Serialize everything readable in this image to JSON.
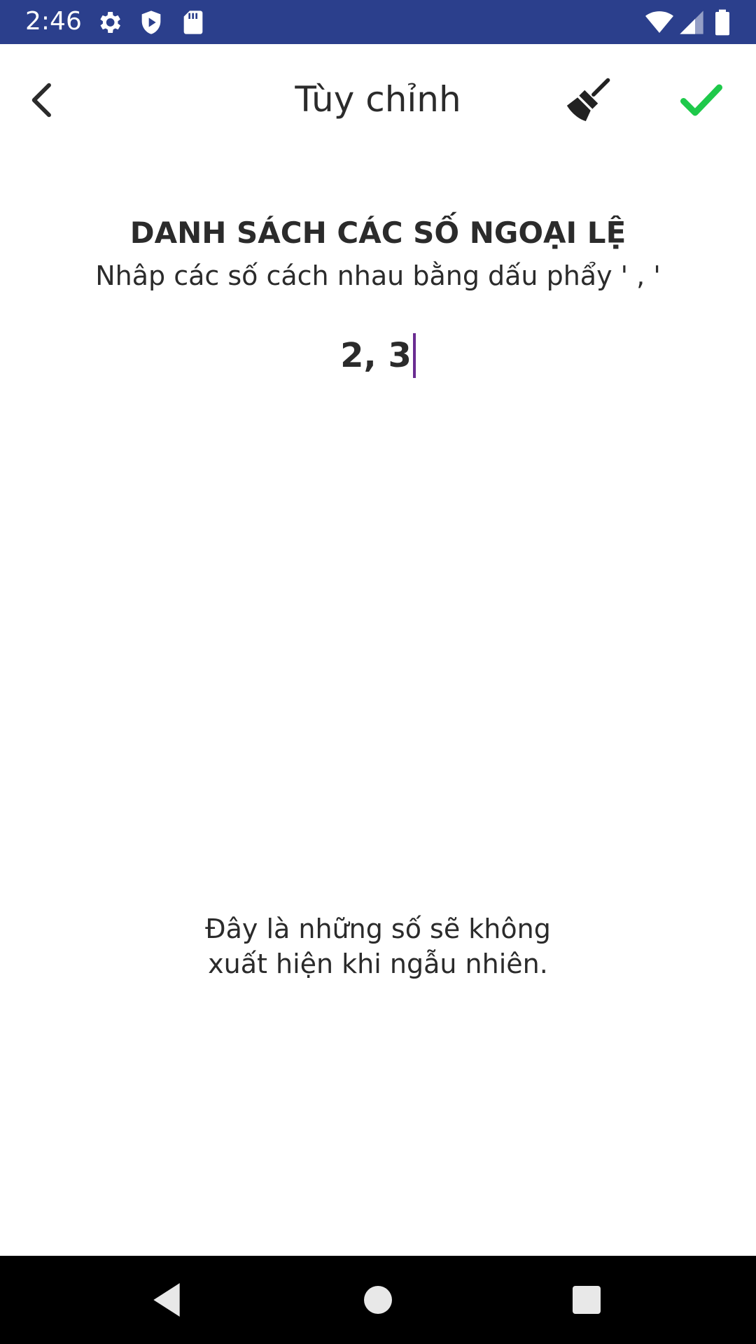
{
  "status_bar": {
    "time": "2:46",
    "background_color": "#2b3f8c",
    "icons": [
      "settings-icon",
      "shield-icon",
      "sd-card-icon",
      "wifi-icon",
      "signal-icon",
      "battery-icon"
    ]
  },
  "toolbar": {
    "title": "Tùy chỉnh",
    "back_icon": "chevron-left-icon",
    "clear_icon": "broom-icon",
    "confirm_icon": "checkmark-icon",
    "confirm_color": "#1ec94a"
  },
  "content": {
    "heading": "DANH SÁCH CÁC SỐ NGOẠI LỆ",
    "subheading": "Nhâp các số cách nhau bằng dấu phẩy  ' , '",
    "input_value": "2, 3",
    "cursor_color": "#6a2c91",
    "info_text": "Đây là những số sẽ không\n xuất hiện khi ngẫu nhiên."
  },
  "nav_bar": {
    "icons": [
      "nav-back-icon",
      "nav-home-icon",
      "nav-recents-icon"
    ]
  }
}
